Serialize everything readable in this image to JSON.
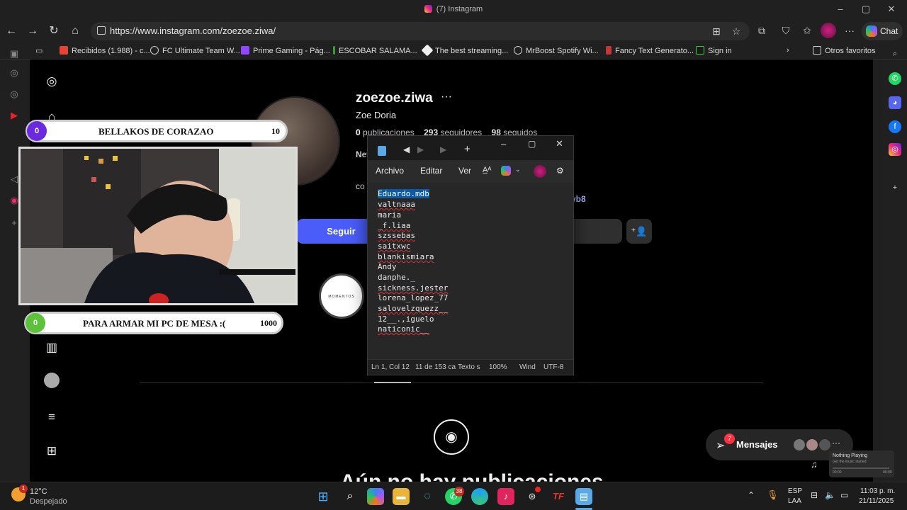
{
  "window": {
    "title": "(7) Instagram"
  },
  "browser": {
    "url": "https://www.instagram.com/zoezoe.ziwa/",
    "chat_label": "Chat",
    "bookmarks": [
      "Recibidos (1.988) - c...",
      "FC Ultimate Team W...",
      "Prime Gaming - Pág...",
      "ESCOBAR SALAMA...",
      "The best streaming...",
      "MrBoost Spotify Wi...",
      "Fancy Text Generato...",
      "Sign in"
    ],
    "other_favorites": "Otros favoritos"
  },
  "profile": {
    "username": "zoezoe.ziwa",
    "more": "···",
    "full_name": "Zoe Doria",
    "posts_count": "0",
    "posts_label": "publicaciones",
    "followers_count": "293",
    "followers_label": "seguidores",
    "following_count": "98",
    "following_label": "seguidos",
    "bio_line1": "New",
    "bio_line2": "co",
    "bio_link_fragment": "vb8",
    "follow_button": "Seguir",
    "highlight_text": "MOMENTOS",
    "empty_title_fragment": "Aún no hay publicaciones"
  },
  "messages": {
    "label": "Mensajes",
    "badge": "7"
  },
  "overlay": {
    "top_circle": "0",
    "top_label": "BELLAKOS DE CORAZAO",
    "top_value": "10",
    "bottom_circle": "0",
    "bottom_label": "PARA ARMAR MI PC DE MESA :(",
    "bottom_value": "1000"
  },
  "notepad": {
    "menu": [
      "Archivo",
      "Editar",
      "Ver"
    ],
    "lines": [
      "Eduardo.mdb",
      "valtnaaa",
      "maria",
      "_f.liaa",
      "szssebas",
      "saitxwc",
      "blankismiara",
      "Andy",
      "danphe._",
      "sickness.jester",
      "lorena_lopez_77",
      "salovelzquezz__",
      "12__.,iguelo",
      "naticonic__"
    ],
    "status": {
      "position": "Ln 1, Col 12",
      "selection": "11 de 153 ca",
      "format": "Texto s",
      "zoom": "100%",
      "line_ending": "Wind",
      "encoding": "UTF-8"
    }
  },
  "media_widget": {
    "title": "Nothing Playing",
    "subtitle": "Get the music started",
    "time_start": "00:00",
    "time_end": "00:00"
  },
  "taskbar": {
    "temperature": "12°C",
    "weather": "Despejado",
    "whatsapp_badge": "38",
    "language": "ESP",
    "region": "LAA",
    "time": "11:03 p. m.",
    "date": "21/11/2025"
  },
  "colors": {
    "accent_follow": "#4a5df9",
    "selection": "#0b5aa8",
    "top_circle": "#6a2be0",
    "bottom_circle": "#5cc23c"
  }
}
